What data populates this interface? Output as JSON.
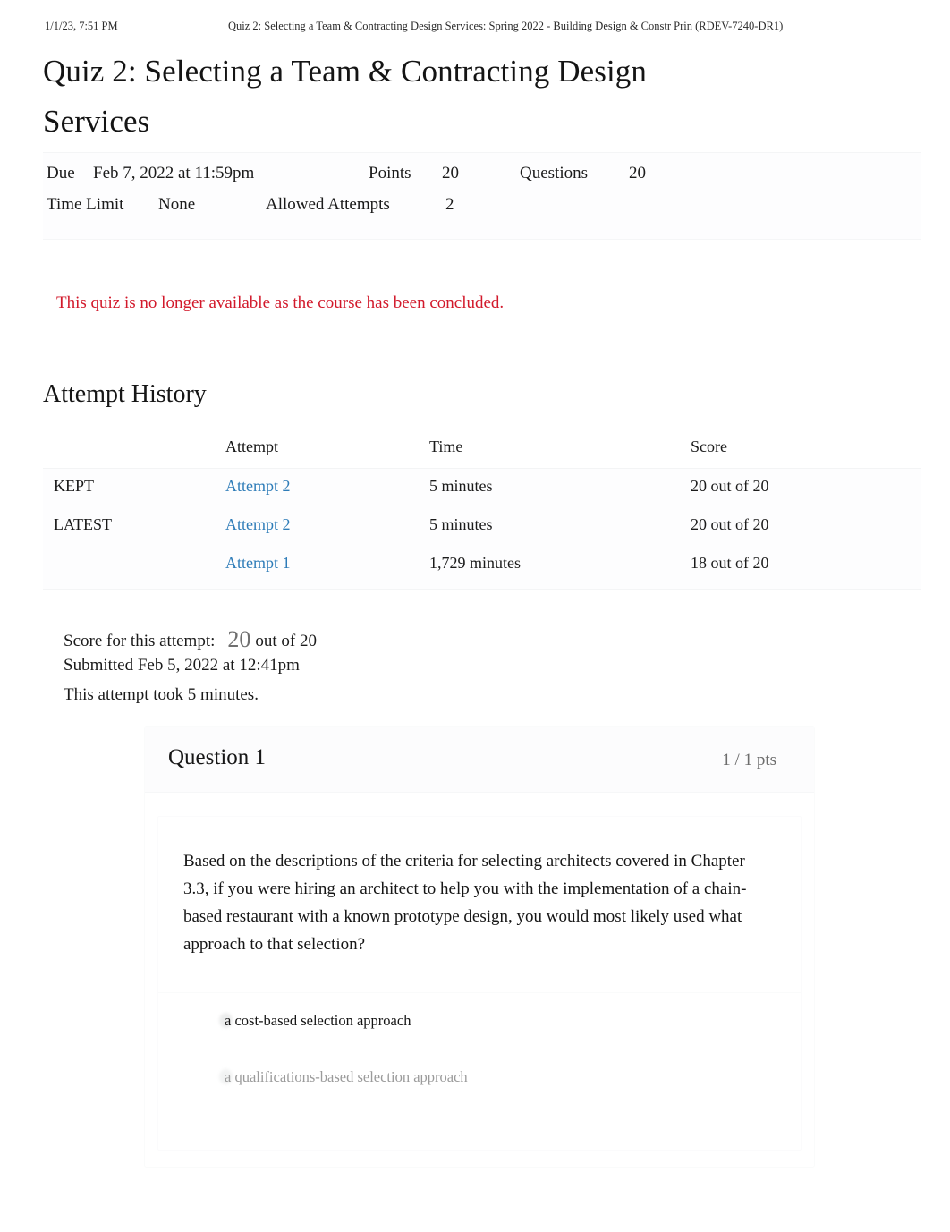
{
  "print_header": {
    "timestamp": "1/1/23, 7:51 PM",
    "document_title": "Quiz 2: Selecting a Team & Contracting Design Services: Spring 2022 - Building Design & Constr Prin (RDEV-7240-DR1)"
  },
  "quiz": {
    "title": "Quiz 2: Selecting a Team & Contracting Design Services",
    "details": {
      "due_label": "Due",
      "due_value": "Feb 7, 2022 at 11:59pm",
      "points_label": "Points",
      "points_value": "20",
      "questions_label": "Questions",
      "questions_value": "20",
      "time_limit_label": "Time Limit",
      "time_limit_value": "None",
      "allowed_attempts_label": "Allowed Attempts",
      "allowed_attempts_value": "2"
    },
    "alert": "This quiz is no longer available as the course has been concluded."
  },
  "attempt_history": {
    "heading": "Attempt History",
    "columns": {
      "flag": "",
      "attempt": "Attempt",
      "time": "Time",
      "score": "Score"
    },
    "rows": [
      {
        "flag": "KEPT",
        "attempt": "Attempt 2",
        "time": "5 minutes",
        "score": "20 out of 20"
      },
      {
        "flag": "LATEST",
        "attempt": "Attempt 2",
        "time": "5 minutes",
        "score": "20 out of 20"
      },
      {
        "flag": "",
        "attempt": "Attempt 1",
        "time": "1,729 minutes",
        "score": "18 out of 20"
      }
    ]
  },
  "attempt_summary": {
    "score_label": "Score for this attempt:",
    "score_value": "20",
    "score_out_of": "out of 20",
    "submitted": "Submitted Feb 5, 2022 at 12:41pm",
    "duration": "This attempt took 5 minutes."
  },
  "question": {
    "title": "Question 1",
    "points": "1 / 1 pts",
    "text": "Based on the descriptions of the criteria for selecting architects covered in Chapter 3.3, if you were hiring an architect to help you with the implementation of a chain-based restaurant with a known prototype design, you would most likely used what approach to that selection?",
    "answers": [
      {
        "label": "a cost-based selection approach"
      },
      {
        "label": "a qualifications-based selection approach"
      }
    ]
  },
  "colors": {
    "link": "#2e7cb8",
    "alert": "#d2192b",
    "muted": "#6d6d6d",
    "text": "#161616"
  }
}
